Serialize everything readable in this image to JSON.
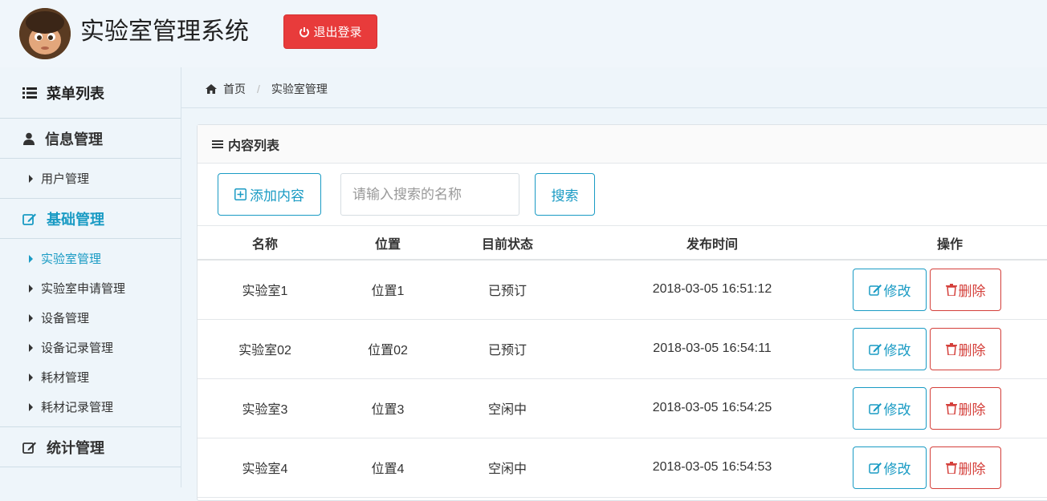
{
  "header": {
    "app_title": "实验室管理系统",
    "logout_label": "退出登录"
  },
  "sidebar": {
    "menu_title": "菜单列表",
    "groups": [
      {
        "label": "信息管理",
        "items": [
          {
            "label": "用户管理"
          }
        ]
      },
      {
        "label": "基础管理",
        "items": [
          {
            "label": "实验室管理"
          },
          {
            "label": "实验室申请管理"
          },
          {
            "label": "设备管理"
          },
          {
            "label": "设备记录管理"
          },
          {
            "label": "耗材管理"
          },
          {
            "label": "耗材记录管理"
          }
        ]
      },
      {
        "label": "统计管理",
        "items": []
      }
    ]
  },
  "breadcrumb": {
    "home": "首页",
    "current": "实验室管理"
  },
  "panel": {
    "title": "内容列表",
    "add_label": "添加内容",
    "search_placeholder": "请输入搜索的名称",
    "search_label": "搜索"
  },
  "table": {
    "columns": [
      "名称",
      "位置",
      "目前状态",
      "发布时间",
      "操作"
    ],
    "edit_label": "修改",
    "delete_label": "删除",
    "rows": [
      {
        "name": "实验室1",
        "location": "位置1",
        "status": "已预订",
        "time": "2018-03-05 16:51:12"
      },
      {
        "name": "实验室02",
        "location": "位置02",
        "status": "已预订",
        "time": "2018-03-05 16:54:11"
      },
      {
        "name": "实验室3",
        "location": "位置3",
        "status": "空闲中",
        "time": "2018-03-05 16:54:25"
      },
      {
        "name": "实验室4",
        "location": "位置4",
        "status": "空闲中",
        "time": "2018-03-05 16:54:53"
      }
    ]
  },
  "colors": {
    "accent": "#1a9bc4",
    "danger": "#e83b3b"
  }
}
